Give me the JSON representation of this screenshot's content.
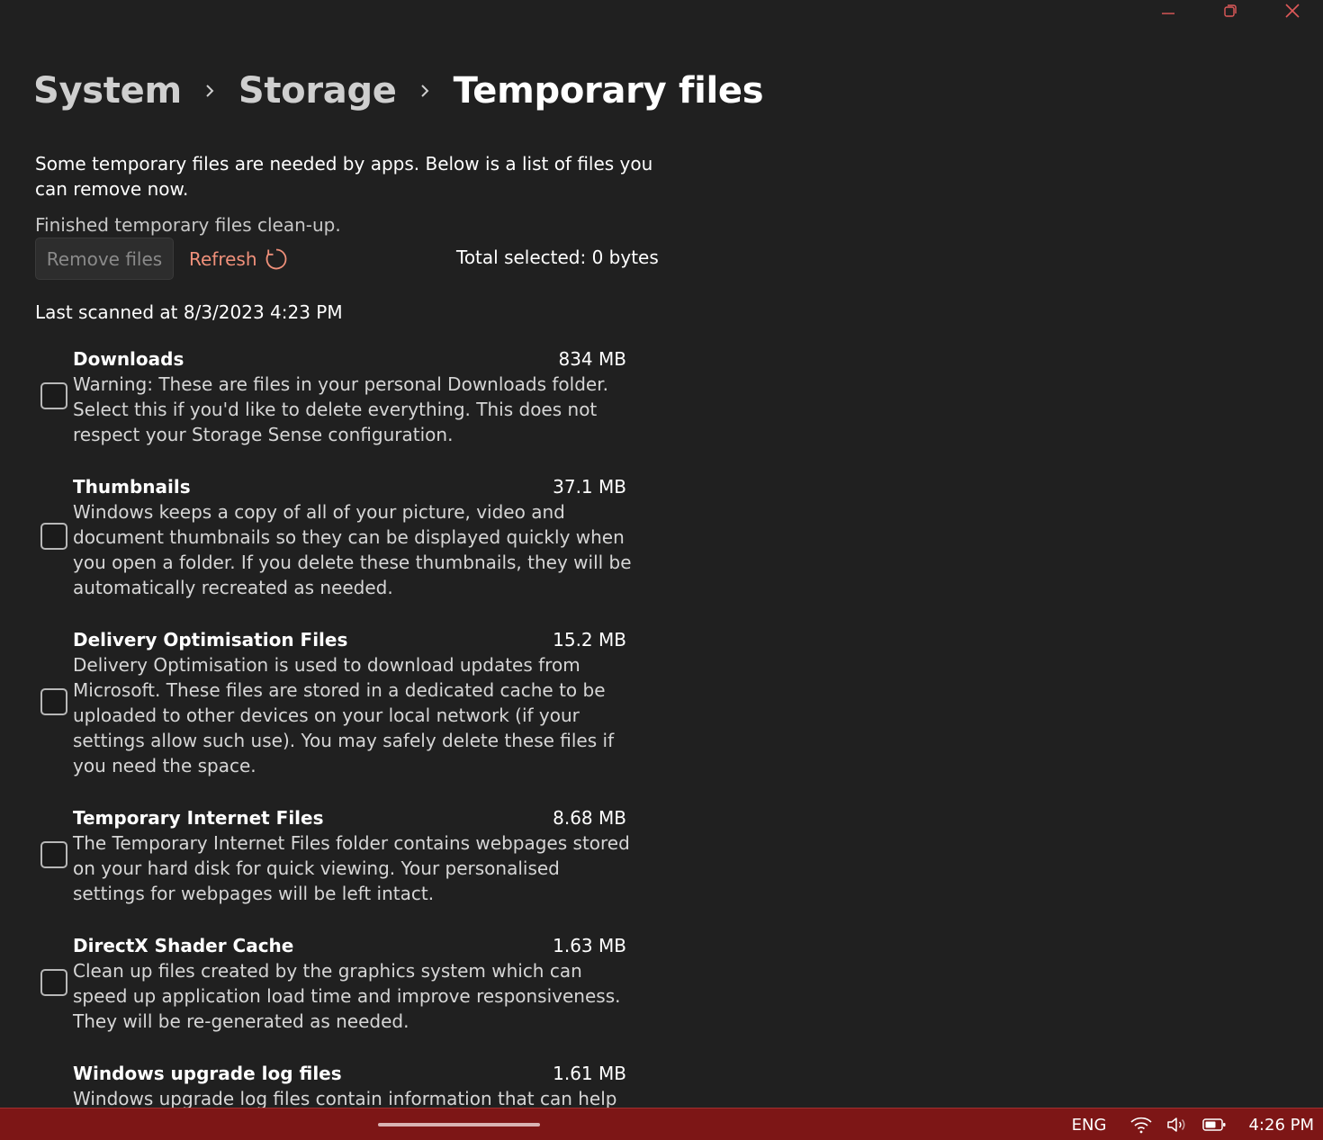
{
  "window": {
    "controls": [
      "minimize",
      "restore",
      "close"
    ]
  },
  "breadcrumb": {
    "items": [
      "System",
      "Storage",
      "Temporary files"
    ]
  },
  "intro_text": "Some temporary files are needed by apps. Below is a list of files you can remove now.",
  "status_text": "Finished temporary files clean-up.",
  "actions": {
    "remove_label": "Remove files",
    "refresh_label": "Refresh",
    "total_selected": "Total selected: 0 bytes"
  },
  "last_scanned": "Last scanned at 8/3/2023 4:23 PM",
  "items": [
    {
      "title": "Downloads",
      "size": "834 MB",
      "checked": false,
      "description": "Warning: These are files in your personal Downloads folder. Select this if you'd like to delete everything. This does not respect your Storage Sense configuration."
    },
    {
      "title": "Thumbnails",
      "size": "37.1 MB",
      "checked": false,
      "description": "Windows keeps a copy of all of your picture, video and document thumbnails so they can be displayed quickly when you open a folder. If you delete these thumbnails, they will be automatically recreated as needed."
    },
    {
      "title": "Delivery Optimisation Files",
      "size": "15.2 MB",
      "checked": false,
      "description": "Delivery Optimisation is used to download updates from Microsoft. These files are stored in a dedicated cache to be uploaded to other devices on your local network (if your settings allow such use). You may safely delete these files if you need the space."
    },
    {
      "title": "Temporary Internet Files",
      "size": "8.68 MB",
      "checked": false,
      "description": "The Temporary Internet Files folder contains webpages stored on your hard disk for quick viewing. Your personalised settings for webpages will be left intact."
    },
    {
      "title": "DirectX Shader Cache",
      "size": "1.63 MB",
      "checked": false,
      "description": "Clean up files created by the graphics system which can speed up application load time and improve responsiveness. They will be re-generated as needed."
    },
    {
      "title": "Windows upgrade log files",
      "size": "1.61 MB",
      "checked": false,
      "description": "Windows upgrade log files contain information that can help"
    }
  ],
  "taskbar": {
    "language": "ENG",
    "time": "4:26 PM",
    "tray_icons": [
      "wifi-icon",
      "volume-icon",
      "battery-icon"
    ]
  },
  "colors": {
    "background": "#202020",
    "accent_link": "#f0907a",
    "taskbar": "#7d1616"
  }
}
